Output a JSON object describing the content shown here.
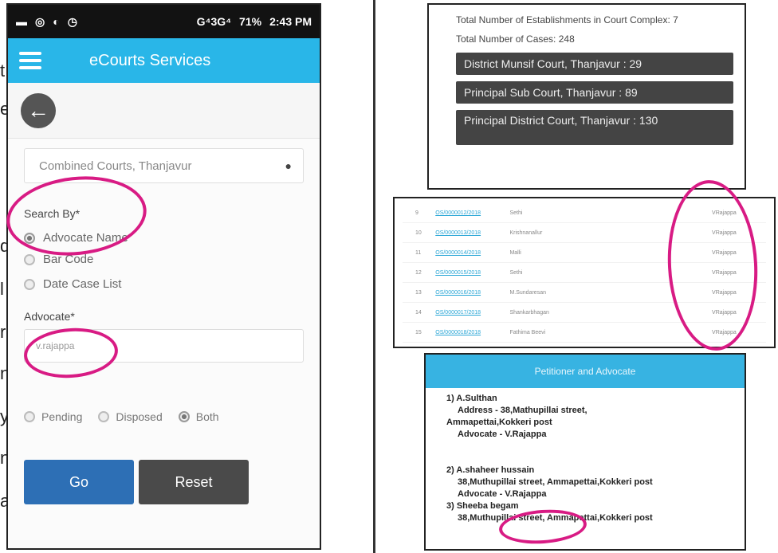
{
  "left_fragments": [
    "t",
    "e",
    "d",
    "l",
    "r",
    "n",
    "y",
    "n",
    "a"
  ],
  "phone": {
    "status_bar": {
      "time": "2:43 PM",
      "battery": "71%",
      "network": "G⁴3G⁴"
    },
    "app_title": "eCourts Services",
    "court_select": "Combined Courts, Thanjavur",
    "search_by_label": "Search By*",
    "search_options": [
      "Advocate Name",
      "Bar Code",
      "Date Case List"
    ],
    "advocate_label": "Advocate*",
    "advocate_value": "v.rajappa",
    "status_options": [
      "Pending",
      "Disposed",
      "Both"
    ],
    "go_label": "Go",
    "reset_label": "Reset"
  },
  "totals": {
    "establishments": "Total Number of Establishments in Court Complex: 7",
    "cases": "Total Number of Cases: 248",
    "courts": [
      "District Munsif Court, Thanjavur : 29",
      "Principal Sub Court, Thanjavur : 89",
      "Principal District Court, Thanjavur : 130"
    ]
  },
  "case_rows": [
    {
      "num": "9",
      "link": "OS/0000012/2018",
      "party": "Sethi",
      "adv": "VRajappa"
    },
    {
      "num": "10",
      "link": "OS/0000013/2018",
      "party": "Krishnanallur",
      "adv": "VRajappa"
    },
    {
      "num": "11",
      "link": "OS/0000014/2018",
      "party": "Malli",
      "adv": "VRajappa"
    },
    {
      "num": "12",
      "link": "OS/0000015/2018",
      "party": "Sethi",
      "adv": "VRajappa"
    },
    {
      "num": "13",
      "link": "OS/0000016/2018",
      "party": "M.Sundaresan",
      "adv": "VRajappa"
    },
    {
      "num": "14",
      "link": "OS/0000017/2018",
      "party": "Shankarbhagan",
      "adv": "VRajappa"
    },
    {
      "num": "15",
      "link": "OS/0000018/2018",
      "party": "Fathima Beevi",
      "adv": "VRajappa"
    }
  ],
  "details": {
    "header": "Petitioner and Advocate",
    "p1_name": "1) A.Sulthan",
    "p1_address": "Address - 38,Mathupillai street,",
    "p1_address2": "Ammapettai,Kokkeri post",
    "p1_adv": "Advocate - V.Rajappa",
    "p2_name": "2) A.shaheer hussain",
    "p2_address": "38,Muthupillai street, Ammapettai,Kokkeri post",
    "p2_adv": "Advocate - V.Rajappa",
    "p3_name": "3) Sheeba begam",
    "p3_address": "38,Muthupillai street, Ammapettai,Kokkeri post"
  },
  "colors": {
    "accent": "#29b6e8",
    "highlight": "#d81b84",
    "go": "#2d6fb5",
    "reset": "#4a4a4a"
  }
}
